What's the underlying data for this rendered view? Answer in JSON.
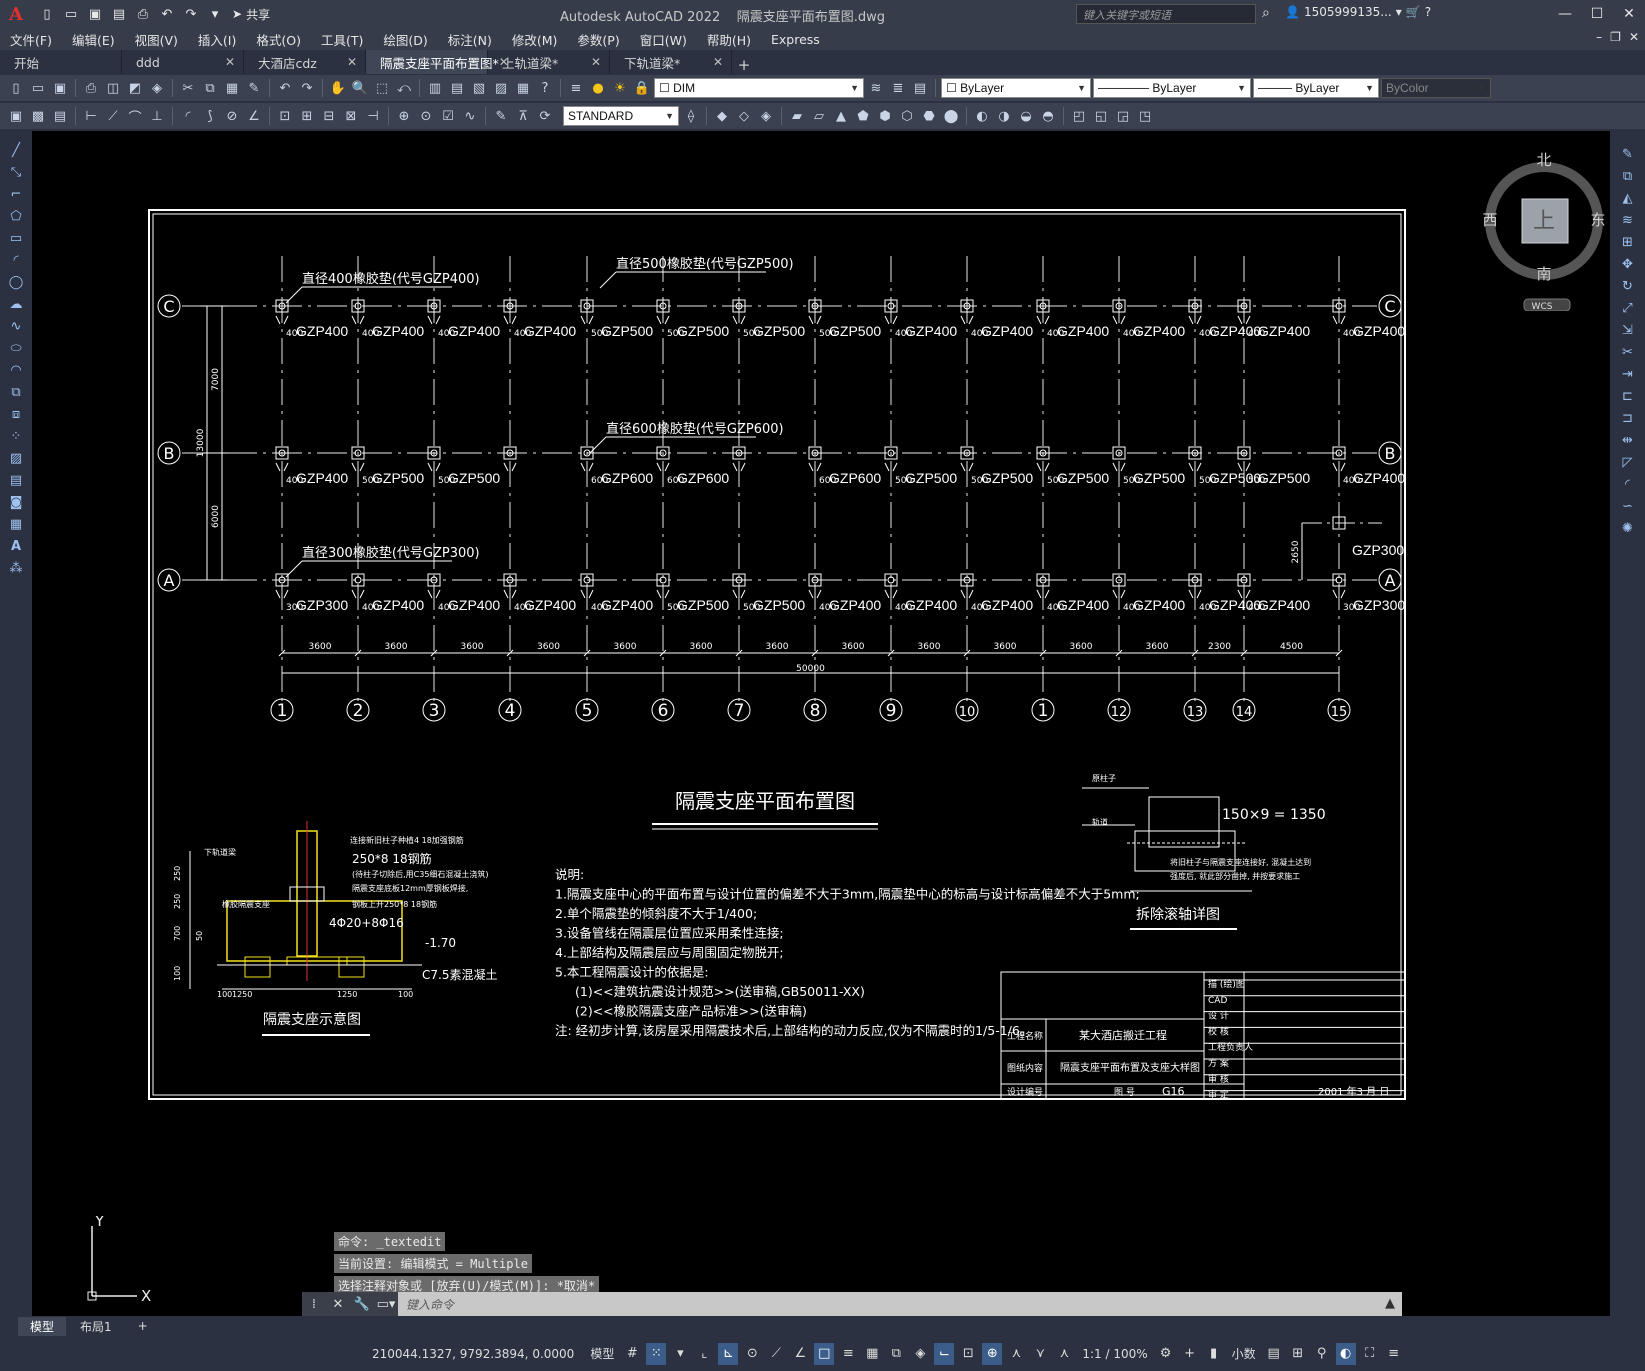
{
  "app": {
    "title": "Autodesk AutoCAD 2022",
    "filename": "隔震支座平面布置图.dwg",
    "logo": "A"
  },
  "qat": {
    "share_label": "共享"
  },
  "search": {
    "placeholder": "键入关键字或短语"
  },
  "user": {
    "name": "1505999135..."
  },
  "menu": [
    "文件(F)",
    "编辑(E)",
    "视图(V)",
    "插入(I)",
    "格式(O)",
    "工具(T)",
    "绘图(D)",
    "标注(N)",
    "修改(M)",
    "参数(P)",
    "窗口(W)",
    "帮助(H)",
    "Express"
  ],
  "tabs": [
    {
      "label": "开始",
      "active": false,
      "closable": false
    },
    {
      "label": "ddd",
      "active": false,
      "closable": true
    },
    {
      "label": "大酒店cdz",
      "active": false,
      "closable": true
    },
    {
      "label": "隔震支座平面布置图*",
      "active": true,
      "closable": true
    },
    {
      "label": "上轨道梁*",
      "active": false,
      "closable": true
    },
    {
      "label": "下轨道梁*",
      "active": false,
      "closable": true
    }
  ],
  "toolbar": {
    "dimstyle": "DIM",
    "textstyle": "STANDARD",
    "layer": "ByLayer",
    "linetype": "ByLayer",
    "lineweight": "ByLayer",
    "color": "ByColor"
  },
  "viewcube": {
    "north": "北",
    "south": "南",
    "east": "东",
    "west": "西",
    "face": "上",
    "wcs": "WCS"
  },
  "ucs": {
    "x": "X",
    "y": "Y"
  },
  "drawing": {
    "title": "隔震支座平面布置图",
    "rows": [
      {
        "label": "C",
        "types": [
          "400",
          "400",
          "400",
          "400",
          "500",
          "500",
          "500",
          "500",
          "400",
          "400",
          "400",
          "400",
          "400",
          "400",
          "400"
        ]
      },
      {
        "label": "B",
        "types": [
          "400",
          "500",
          "500",
          "",
          "600",
          "600",
          "",
          "600",
          "500",
          "500",
          "500",
          "500",
          "500",
          "500",
          "400"
        ]
      },
      {
        "label": "A",
        "types": [
          "300",
          "400",
          "400",
          "400",
          "400",
          "500",
          "500",
          "400",
          "400",
          "400",
          "400",
          "400",
          "400",
          "400",
          "300"
        ]
      }
    ],
    "callouts": [
      "直径400橡胶垫(代号GZP400)",
      "直径500橡胶垫(代号GZP500)",
      "直径600橡胶垫(代号GZP600)",
      "直径300橡胶垫(代号GZP300)"
    ],
    "axis_labels": [
      "1",
      "2",
      "3",
      "4",
      "5",
      "6",
      "7",
      "8",
      "9",
      "10",
      "1",
      "12",
      "13",
      "14",
      "15"
    ],
    "spans": [
      "3600",
      "3600",
      "3600",
      "3600",
      "3600",
      "3600",
      "3600",
      "3600",
      "3600",
      "3600",
      "3600",
      "3600",
      "2300",
      "4500"
    ],
    "total": "50000",
    "vdims": [
      "7000",
      "13000",
      "6000",
      "2650"
    ],
    "extra_label": "GZP300",
    "notes": [
      "说明:",
      "1.隔震支座中心的平面布置与设计位置的偏差不大于3mm,隔震垫中心的标高与设计标高偏差不大于5mm;",
      "2.单个隔震垫的倾斜度不大于1/400;",
      "3.设备管线在隔震层位置应采用柔性连接;",
      "4.上部结构及隔震层应与周围固定物脱开;",
      "5.本工程隔震设计的依据是:",
      "(1)<<建筑抗震设计规范>>(送审稿,GB50011-XX)",
      "(2)<<橡胶隔震支座产品标准>>(送审稿)",
      "注: 经初步计算,该房屋采用隔震技术后,上部结构的动力反应,仅为不隔震时的1/5-1/6。"
    ],
    "detail_left": {
      "title": "隔震支座示意图",
      "labels": [
        "下轨道梁",
        "连接新旧柱子种植4 18加强钢筋",
        "250*8 18钢筋",
        "(待柱子切除后,用C35细石混凝土浇筑)",
        "隔震支座底板12mm厚钢板焊接,",
        "钢板上开250*8 18钢筋",
        "橡胶隔震支座",
        "4Φ20+8Φ16",
        "-1.70",
        "C7.5素混凝土",
        "250",
        "250",
        "700",
        "50",
        "100",
        "1250",
        "1250",
        "100",
        "100"
      ]
    },
    "detail_right": {
      "title": "拆除滚轴详图",
      "labels": [
        "原柱子",
        "轨道",
        "150×9 = 1350",
        "将旧柱子与隔震支座连接好, 混凝土达到",
        "强度后, 就此部分凿掉, 并按要求施工"
      ]
    },
    "titleblock": {
      "project_label": "工程名称",
      "project": "某大酒店搬迁工程",
      "content_label": "图纸内容",
      "content": "隔震支座平面布置及支座大样图",
      "design_no_label": "设计编号",
      "sheet_label": "图 号",
      "sheet": "G16",
      "date": "2001 年3 月 日",
      "roles": [
        "描 (绘)图",
        "CAD",
        "设 计",
        "校 核",
        "工程负责人",
        "方 案",
        "审 核",
        "审 定"
      ]
    }
  },
  "command": {
    "history": [
      "命令: _textedit",
      "当前设置: 编辑模式 = Multiple",
      "选择注释对象或 [放弃(U)/模式(M)]: *取消*"
    ],
    "placeholder": "键入命令"
  },
  "layouts": [
    {
      "label": "模型",
      "active": true
    },
    {
      "label": "布局1",
      "active": false
    }
  ],
  "status": {
    "coords": "210044.1327, 9792.3894, 0.0000",
    "model": "模型",
    "scale": "1:1 / 100%",
    "units": "小数"
  }
}
